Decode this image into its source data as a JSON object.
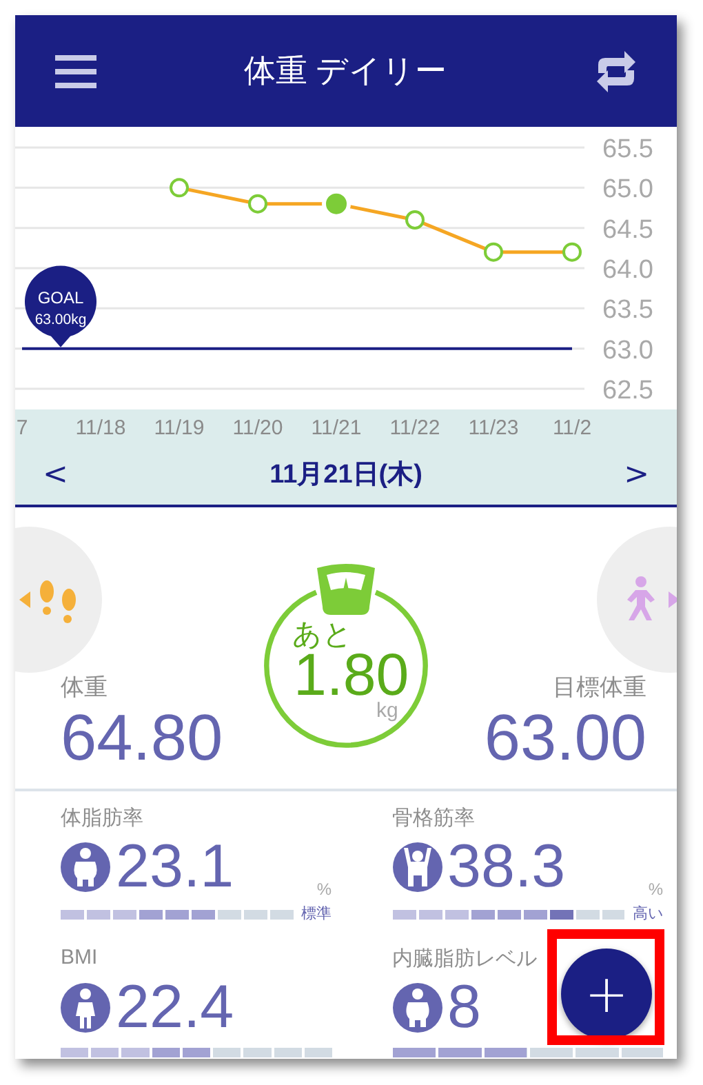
{
  "header": {
    "title": "体重 デイリー"
  },
  "chart": {
    "chart_data": {
      "type": "line",
      "categories": [
        "7",
        "11/18",
        "11/19",
        "11/20",
        "11/21",
        "11/22",
        "11/23",
        "11/2"
      ],
      "series": [
        {
          "color": "#f5a623",
          "marker": "circle",
          "values": [
            null,
            null,
            65.0,
            64.8,
            64.8,
            64.6,
            64.2,
            64.2
          ]
        },
        {
          "color": "#1b1f84",
          "marker": "none",
          "values": [
            63,
            63,
            63,
            63,
            63,
            63,
            63,
            63
          ]
        }
      ],
      "grid": true,
      "ylim": [
        62.5,
        65.5
      ],
      "yticks": [
        {
          "value": 65.5,
          "label": "65.5"
        },
        {
          "value": 65,
          "label": "65.0"
        },
        {
          "value": 64.5,
          "label": "64.5"
        },
        {
          "value": 64,
          "label": "64.0"
        },
        {
          "value": 63.5,
          "label": "63.5"
        },
        {
          "value": 63,
          "label": "63.0"
        },
        {
          "value": 62.5,
          "label": "62.5"
        }
      ],
      "annotations": [
        "GOAL",
        "63.00kg"
      ]
    },
    "points": [
      {
        "selected": false
      },
      {
        "selected": false
      },
      {
        "selected": true
      },
      {
        "selected": false
      },
      {
        "selected": false
      },
      {
        "selected": false
      }
    ]
  },
  "date_bar": {
    "prev": "<",
    "date": "11月21日(木)",
    "next": ">"
  },
  "summary": {
    "remaining_label": "あと",
    "remaining": "1.80",
    "unit": "kg",
    "weight_label": "体重",
    "weight": "64.80",
    "goal_label": "目標体重",
    "goal": "63.00"
  },
  "metrics": [
    {
      "label": "体脂肪率",
      "value": "23.1",
      "unit": "%",
      "status": "標準",
      "kind": "nine_step",
      "level": 0.667
    },
    {
      "label": "骨格筋率",
      "value": "38.3",
      "unit": "%",
      "status": "高い",
      "kind": "nine_step",
      "level": 0.778
    },
    {
      "label": "BMI",
      "value": "22.4",
      "kind": "nine_step",
      "level": 0.556
    },
    {
      "label": "内臓脂肪レベル",
      "value": "8",
      "kind": "six_step",
      "level": 0.5
    }
  ],
  "fab": {
    "label": "+"
  }
}
